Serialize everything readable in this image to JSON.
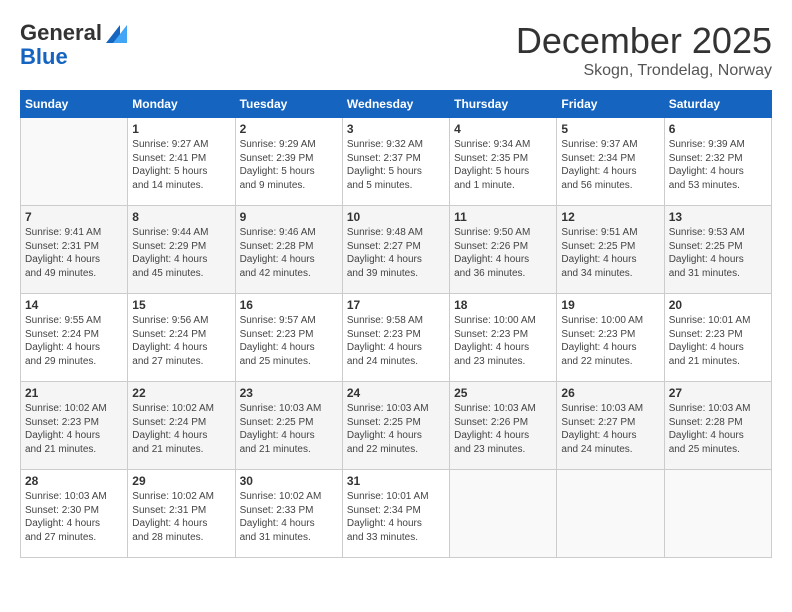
{
  "header": {
    "logo_line1": "General",
    "logo_line2": "Blue",
    "month": "December 2025",
    "location": "Skogn, Trondelag, Norway"
  },
  "weekdays": [
    "Sunday",
    "Monday",
    "Tuesday",
    "Wednesday",
    "Thursday",
    "Friday",
    "Saturday"
  ],
  "weeks": [
    [
      {
        "day": "",
        "info": ""
      },
      {
        "day": "1",
        "info": "Sunrise: 9:27 AM\nSunset: 2:41 PM\nDaylight: 5 hours\nand 14 minutes."
      },
      {
        "day": "2",
        "info": "Sunrise: 9:29 AM\nSunset: 2:39 PM\nDaylight: 5 hours\nand 9 minutes."
      },
      {
        "day": "3",
        "info": "Sunrise: 9:32 AM\nSunset: 2:37 PM\nDaylight: 5 hours\nand 5 minutes."
      },
      {
        "day": "4",
        "info": "Sunrise: 9:34 AM\nSunset: 2:35 PM\nDaylight: 5 hours\nand 1 minute."
      },
      {
        "day": "5",
        "info": "Sunrise: 9:37 AM\nSunset: 2:34 PM\nDaylight: 4 hours\nand 56 minutes."
      },
      {
        "day": "6",
        "info": "Sunrise: 9:39 AM\nSunset: 2:32 PM\nDaylight: 4 hours\nand 53 minutes."
      }
    ],
    [
      {
        "day": "7",
        "info": "Sunrise: 9:41 AM\nSunset: 2:31 PM\nDaylight: 4 hours\nand 49 minutes."
      },
      {
        "day": "8",
        "info": "Sunrise: 9:44 AM\nSunset: 2:29 PM\nDaylight: 4 hours\nand 45 minutes."
      },
      {
        "day": "9",
        "info": "Sunrise: 9:46 AM\nSunset: 2:28 PM\nDaylight: 4 hours\nand 42 minutes."
      },
      {
        "day": "10",
        "info": "Sunrise: 9:48 AM\nSunset: 2:27 PM\nDaylight: 4 hours\nand 39 minutes."
      },
      {
        "day": "11",
        "info": "Sunrise: 9:50 AM\nSunset: 2:26 PM\nDaylight: 4 hours\nand 36 minutes."
      },
      {
        "day": "12",
        "info": "Sunrise: 9:51 AM\nSunset: 2:25 PM\nDaylight: 4 hours\nand 34 minutes."
      },
      {
        "day": "13",
        "info": "Sunrise: 9:53 AM\nSunset: 2:25 PM\nDaylight: 4 hours\nand 31 minutes."
      }
    ],
    [
      {
        "day": "14",
        "info": "Sunrise: 9:55 AM\nSunset: 2:24 PM\nDaylight: 4 hours\nand 29 minutes."
      },
      {
        "day": "15",
        "info": "Sunrise: 9:56 AM\nSunset: 2:24 PM\nDaylight: 4 hours\nand 27 minutes."
      },
      {
        "day": "16",
        "info": "Sunrise: 9:57 AM\nSunset: 2:23 PM\nDaylight: 4 hours\nand 25 minutes."
      },
      {
        "day": "17",
        "info": "Sunrise: 9:58 AM\nSunset: 2:23 PM\nDaylight: 4 hours\nand 24 minutes."
      },
      {
        "day": "18",
        "info": "Sunrise: 10:00 AM\nSunset: 2:23 PM\nDaylight: 4 hours\nand 23 minutes."
      },
      {
        "day": "19",
        "info": "Sunrise: 10:00 AM\nSunset: 2:23 PM\nDaylight: 4 hours\nand 22 minutes."
      },
      {
        "day": "20",
        "info": "Sunrise: 10:01 AM\nSunset: 2:23 PM\nDaylight: 4 hours\nand 21 minutes."
      }
    ],
    [
      {
        "day": "21",
        "info": "Sunrise: 10:02 AM\nSunset: 2:23 PM\nDaylight: 4 hours\nand 21 minutes."
      },
      {
        "day": "22",
        "info": "Sunrise: 10:02 AM\nSunset: 2:24 PM\nDaylight: 4 hours\nand 21 minutes."
      },
      {
        "day": "23",
        "info": "Sunrise: 10:03 AM\nSunset: 2:25 PM\nDaylight: 4 hours\nand 21 minutes."
      },
      {
        "day": "24",
        "info": "Sunrise: 10:03 AM\nSunset: 2:25 PM\nDaylight: 4 hours\nand 22 minutes."
      },
      {
        "day": "25",
        "info": "Sunrise: 10:03 AM\nSunset: 2:26 PM\nDaylight: 4 hours\nand 23 minutes."
      },
      {
        "day": "26",
        "info": "Sunrise: 10:03 AM\nSunset: 2:27 PM\nDaylight: 4 hours\nand 24 minutes."
      },
      {
        "day": "27",
        "info": "Sunrise: 10:03 AM\nSunset: 2:28 PM\nDaylight: 4 hours\nand 25 minutes."
      }
    ],
    [
      {
        "day": "28",
        "info": "Sunrise: 10:03 AM\nSunset: 2:30 PM\nDaylight: 4 hours\nand 27 minutes."
      },
      {
        "day": "29",
        "info": "Sunrise: 10:02 AM\nSunset: 2:31 PM\nDaylight: 4 hours\nand 28 minutes."
      },
      {
        "day": "30",
        "info": "Sunrise: 10:02 AM\nSunset: 2:33 PM\nDaylight: 4 hours\nand 31 minutes."
      },
      {
        "day": "31",
        "info": "Sunrise: 10:01 AM\nSunset: 2:34 PM\nDaylight: 4 hours\nand 33 minutes."
      },
      {
        "day": "",
        "info": ""
      },
      {
        "day": "",
        "info": ""
      },
      {
        "day": "",
        "info": ""
      }
    ]
  ]
}
